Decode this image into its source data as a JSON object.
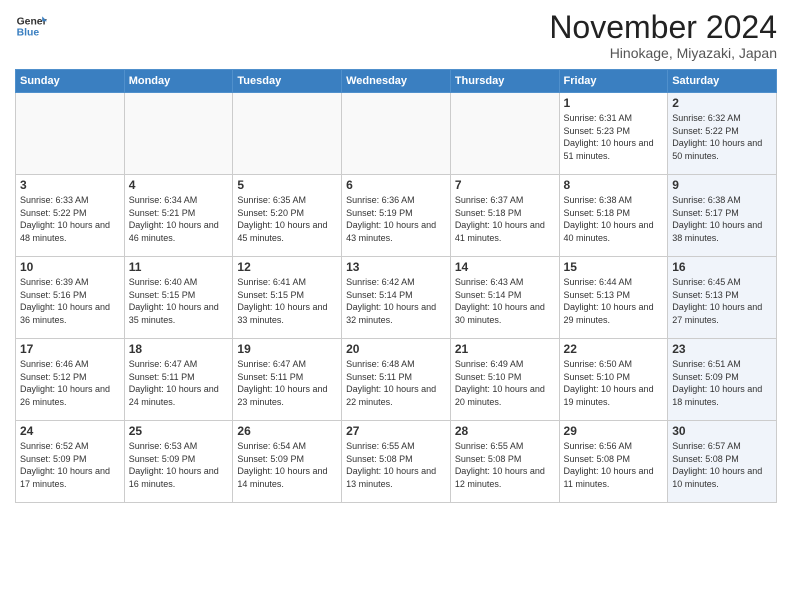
{
  "header": {
    "logo_line1": "General",
    "logo_line2": "Blue",
    "month": "November 2024",
    "location": "Hinokage, Miyazaki, Japan"
  },
  "weekdays": [
    "Sunday",
    "Monday",
    "Tuesday",
    "Wednesday",
    "Thursday",
    "Friday",
    "Saturday"
  ],
  "weeks": [
    [
      {
        "day": "",
        "info": ""
      },
      {
        "day": "",
        "info": ""
      },
      {
        "day": "",
        "info": ""
      },
      {
        "day": "",
        "info": ""
      },
      {
        "day": "",
        "info": ""
      },
      {
        "day": "1",
        "info": "Sunrise: 6:31 AM\nSunset: 5:23 PM\nDaylight: 10 hours and 51 minutes."
      },
      {
        "day": "2",
        "info": "Sunrise: 6:32 AM\nSunset: 5:22 PM\nDaylight: 10 hours and 50 minutes."
      }
    ],
    [
      {
        "day": "3",
        "info": "Sunrise: 6:33 AM\nSunset: 5:22 PM\nDaylight: 10 hours and 48 minutes."
      },
      {
        "day": "4",
        "info": "Sunrise: 6:34 AM\nSunset: 5:21 PM\nDaylight: 10 hours and 46 minutes."
      },
      {
        "day": "5",
        "info": "Sunrise: 6:35 AM\nSunset: 5:20 PM\nDaylight: 10 hours and 45 minutes."
      },
      {
        "day": "6",
        "info": "Sunrise: 6:36 AM\nSunset: 5:19 PM\nDaylight: 10 hours and 43 minutes."
      },
      {
        "day": "7",
        "info": "Sunrise: 6:37 AM\nSunset: 5:18 PM\nDaylight: 10 hours and 41 minutes."
      },
      {
        "day": "8",
        "info": "Sunrise: 6:38 AM\nSunset: 5:18 PM\nDaylight: 10 hours and 40 minutes."
      },
      {
        "day": "9",
        "info": "Sunrise: 6:38 AM\nSunset: 5:17 PM\nDaylight: 10 hours and 38 minutes."
      }
    ],
    [
      {
        "day": "10",
        "info": "Sunrise: 6:39 AM\nSunset: 5:16 PM\nDaylight: 10 hours and 36 minutes."
      },
      {
        "day": "11",
        "info": "Sunrise: 6:40 AM\nSunset: 5:15 PM\nDaylight: 10 hours and 35 minutes."
      },
      {
        "day": "12",
        "info": "Sunrise: 6:41 AM\nSunset: 5:15 PM\nDaylight: 10 hours and 33 minutes."
      },
      {
        "day": "13",
        "info": "Sunrise: 6:42 AM\nSunset: 5:14 PM\nDaylight: 10 hours and 32 minutes."
      },
      {
        "day": "14",
        "info": "Sunrise: 6:43 AM\nSunset: 5:14 PM\nDaylight: 10 hours and 30 minutes."
      },
      {
        "day": "15",
        "info": "Sunrise: 6:44 AM\nSunset: 5:13 PM\nDaylight: 10 hours and 29 minutes."
      },
      {
        "day": "16",
        "info": "Sunrise: 6:45 AM\nSunset: 5:13 PM\nDaylight: 10 hours and 27 minutes."
      }
    ],
    [
      {
        "day": "17",
        "info": "Sunrise: 6:46 AM\nSunset: 5:12 PM\nDaylight: 10 hours and 26 minutes."
      },
      {
        "day": "18",
        "info": "Sunrise: 6:47 AM\nSunset: 5:11 PM\nDaylight: 10 hours and 24 minutes."
      },
      {
        "day": "19",
        "info": "Sunrise: 6:47 AM\nSunset: 5:11 PM\nDaylight: 10 hours and 23 minutes."
      },
      {
        "day": "20",
        "info": "Sunrise: 6:48 AM\nSunset: 5:11 PM\nDaylight: 10 hours and 22 minutes."
      },
      {
        "day": "21",
        "info": "Sunrise: 6:49 AM\nSunset: 5:10 PM\nDaylight: 10 hours and 20 minutes."
      },
      {
        "day": "22",
        "info": "Sunrise: 6:50 AM\nSunset: 5:10 PM\nDaylight: 10 hours and 19 minutes."
      },
      {
        "day": "23",
        "info": "Sunrise: 6:51 AM\nSunset: 5:09 PM\nDaylight: 10 hours and 18 minutes."
      }
    ],
    [
      {
        "day": "24",
        "info": "Sunrise: 6:52 AM\nSunset: 5:09 PM\nDaylight: 10 hours and 17 minutes."
      },
      {
        "day": "25",
        "info": "Sunrise: 6:53 AM\nSunset: 5:09 PM\nDaylight: 10 hours and 16 minutes."
      },
      {
        "day": "26",
        "info": "Sunrise: 6:54 AM\nSunset: 5:09 PM\nDaylight: 10 hours and 14 minutes."
      },
      {
        "day": "27",
        "info": "Sunrise: 6:55 AM\nSunset: 5:08 PM\nDaylight: 10 hours and 13 minutes."
      },
      {
        "day": "28",
        "info": "Sunrise: 6:55 AM\nSunset: 5:08 PM\nDaylight: 10 hours and 12 minutes."
      },
      {
        "day": "29",
        "info": "Sunrise: 6:56 AM\nSunset: 5:08 PM\nDaylight: 10 hours and 11 minutes."
      },
      {
        "day": "30",
        "info": "Sunrise: 6:57 AM\nSunset: 5:08 PM\nDaylight: 10 hours and 10 minutes."
      }
    ]
  ]
}
